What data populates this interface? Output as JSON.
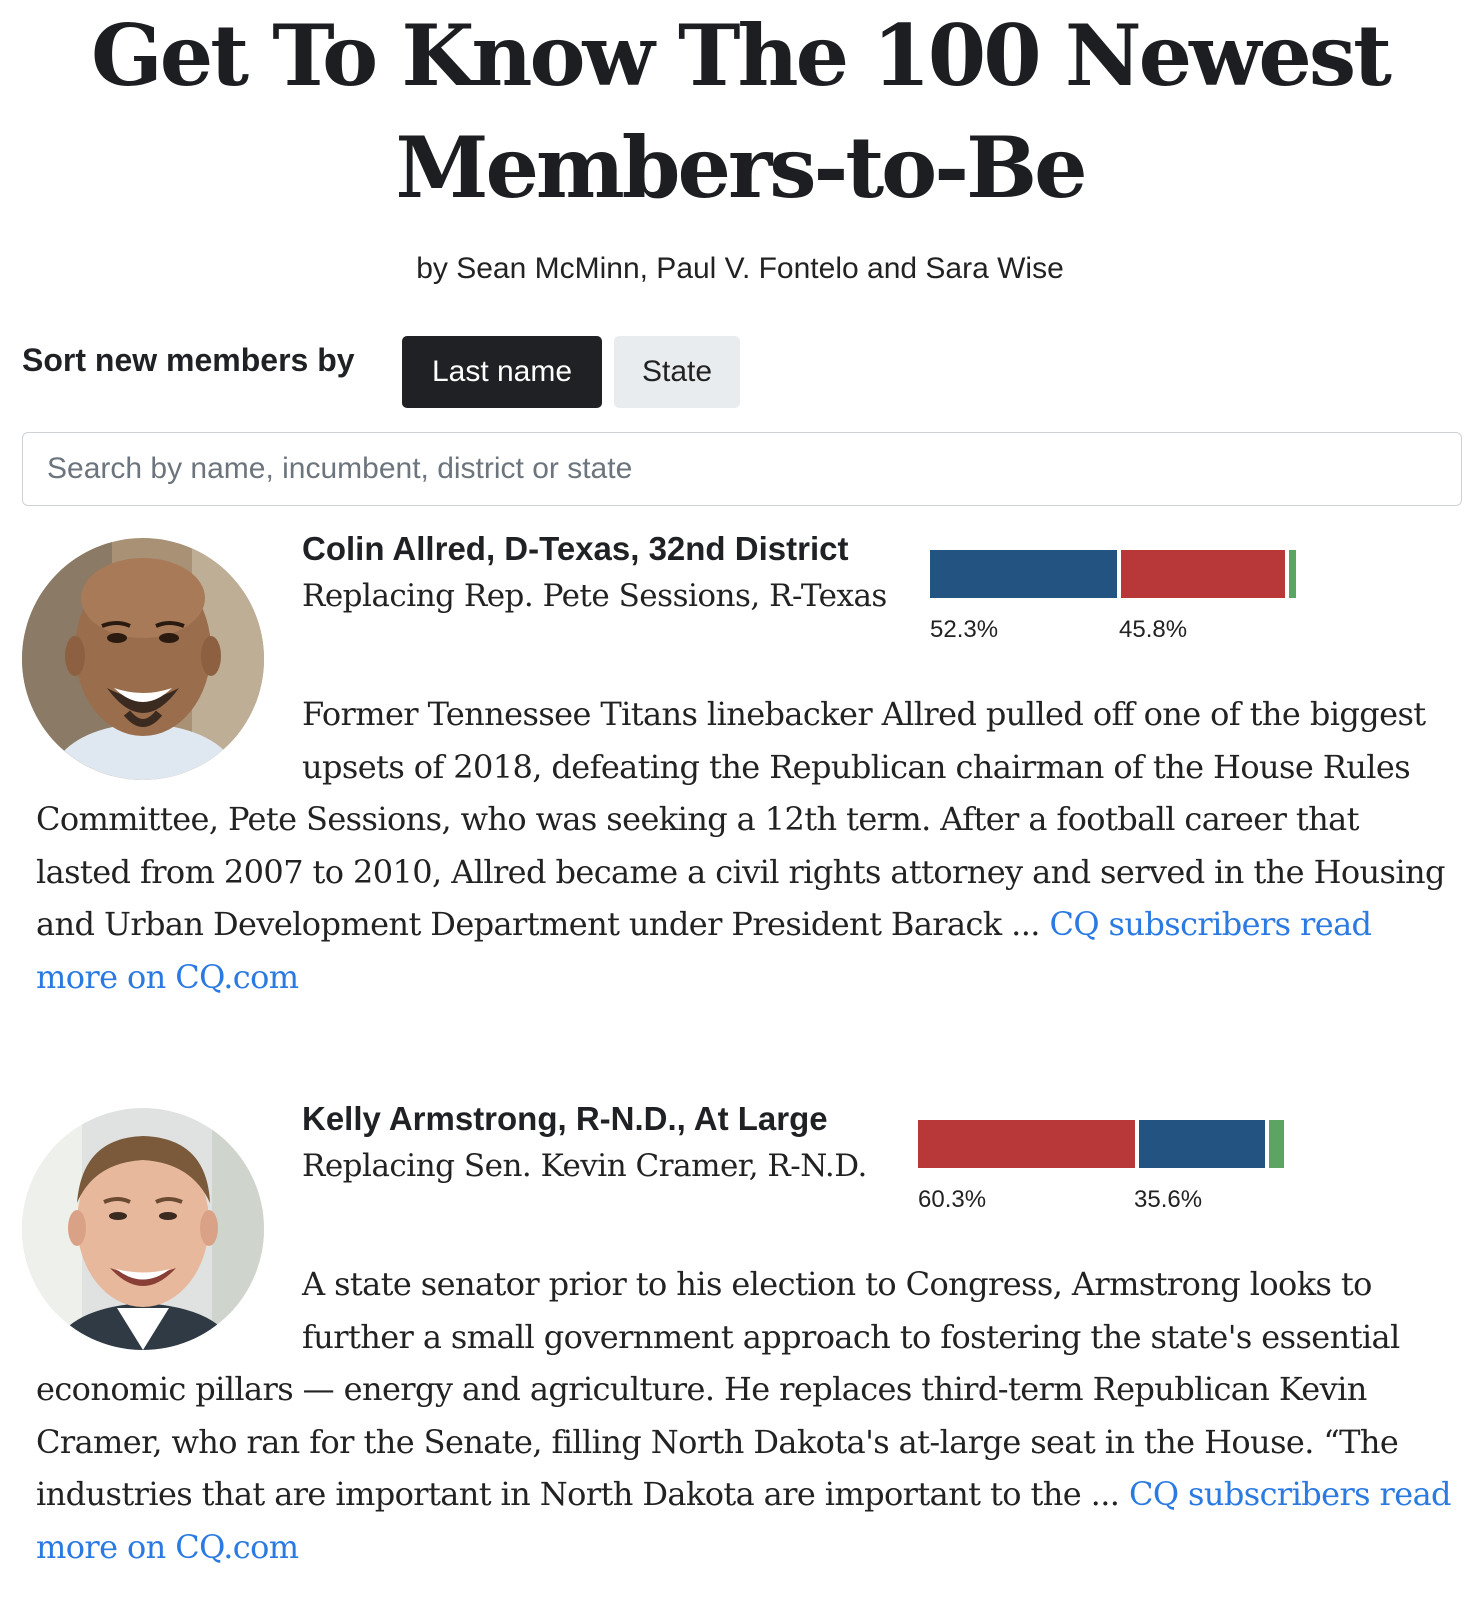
{
  "page": {
    "title": "Get To Know The 100 Newest Members-to-Be",
    "byline": "by Sean McMinn, Paul V. Fontelo and Sara Wise"
  },
  "sort": {
    "label": "Sort new members by",
    "options": [
      {
        "label": "Last name",
        "active": true
      },
      {
        "label": "State",
        "active": false
      }
    ]
  },
  "search": {
    "placeholder": "Search by name, incumbent, district or state",
    "value": ""
  },
  "colors": {
    "democrat": "#235380",
    "republican": "#b8383a",
    "other": "#5ba462",
    "link": "#2a7ae2",
    "active_button": "#1f2124",
    "inactive_button": "#e9ecef"
  },
  "members": [
    {
      "name": "Colin Allred, D-Texas, 32nd District",
      "replacing": "Replacing Rep. Pete Sessions, R-Texas",
      "results": [
        {
          "party": "democrat",
          "percent": 52.3,
          "label": "52.3%"
        },
        {
          "party": "republican",
          "percent": 45.8,
          "label": "45.8%"
        },
        {
          "party": "other",
          "percent": 1.9,
          "label": ""
        }
      ],
      "bio": "Former Tennessee Titans linebacker Allred pulled off one of the biggest upsets of 2018, defeating the Republican chairman of the House Rules Committee, Pete Sessions, who was seeking a 12th term. After a football career that lasted from 2007 to 2010, Allred became a civil rights attorney and served in the Housing and Urban Development Department under President Barack ...",
      "link_text": "CQ subscribers read more on CQ.com"
    },
    {
      "name": "Kelly Armstrong, R-N.D., At Large",
      "replacing": "Replacing Sen. Kevin Cramer, R-N.D.",
      "results": [
        {
          "party": "republican",
          "percent": 60.3,
          "label": "60.3%"
        },
        {
          "party": "democrat",
          "percent": 35.6,
          "label": "35.6%"
        },
        {
          "party": "other",
          "percent": 4.1,
          "label": ""
        }
      ],
      "bio": "A state senator prior to his election to Congress, Armstrong looks to further a small government approach to fostering the state's essential economic pillars — energy and agriculture. He replaces third-term Republican Kevin Cramer, who ran for the Senate, filling North Dakota's at-large seat in the House. “The industries that are important in North Dakota are important to the ...",
      "link_text": "CQ subscribers read more on CQ.com"
    }
  ]
}
